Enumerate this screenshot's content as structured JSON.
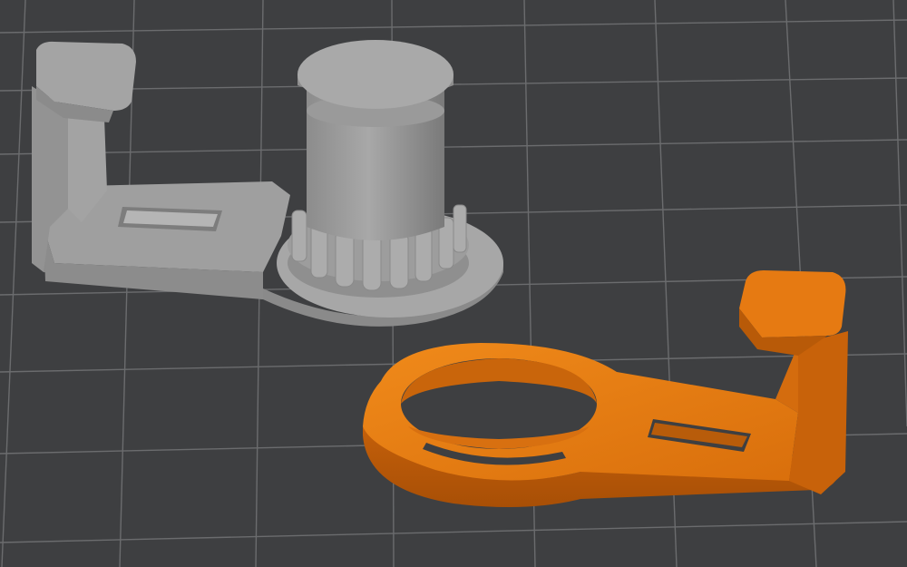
{
  "scene": {
    "background": "#3e3f41",
    "grid_color": "#6b6c6e",
    "objects": [
      {
        "name": "gray-part",
        "description_color": "#a9a9a9",
        "selected": false
      },
      {
        "name": "orange-part",
        "description_color": "#e87a10",
        "selected": true
      }
    ]
  }
}
